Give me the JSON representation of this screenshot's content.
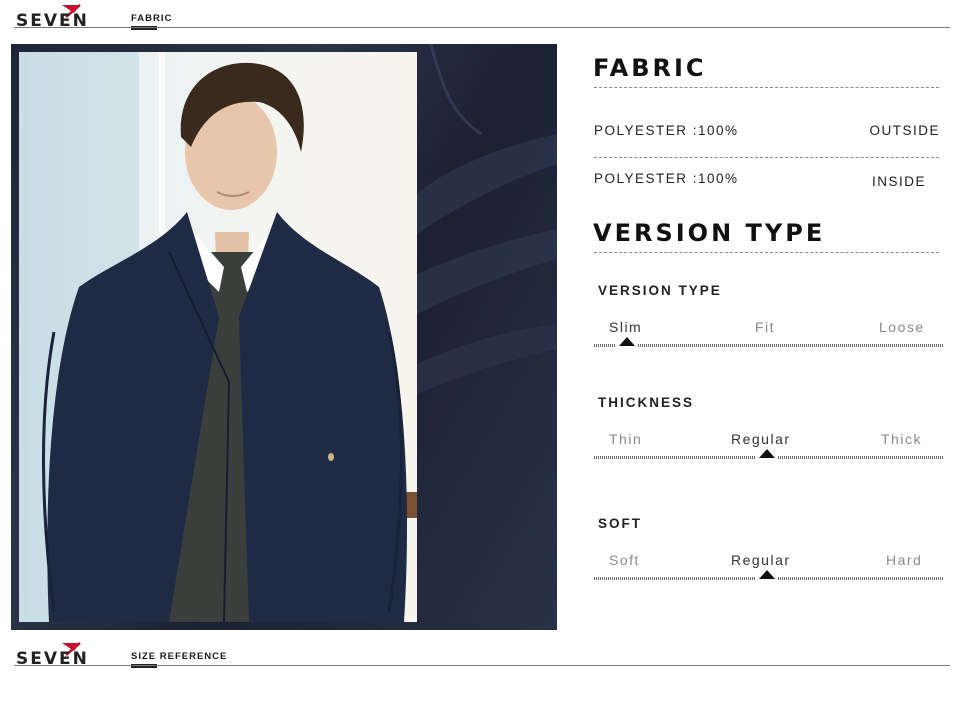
{
  "header": {
    "brand": "SEVEN",
    "section": "FABRIC"
  },
  "fabric": {
    "title": "FABRIC",
    "rows": [
      {
        "value": "POLYESTER :100%",
        "location": "OUTSIDE"
      },
      {
        "value": "POLYESTER :100%",
        "location": "INSIDE"
      }
    ]
  },
  "version": {
    "title": "VERSION TYPE",
    "attributes": [
      {
        "name": "VERSION TYPE",
        "options": [
          "Slim",
          "Fit",
          "Loose"
        ],
        "selected": "Slim"
      },
      {
        "name": "THICKNESS",
        "options": [
          "Thin",
          "Regular",
          "Thick"
        ],
        "selected": "Regular"
      },
      {
        "name": "SOFT",
        "options": [
          "Soft",
          "Regular",
          "Hard"
        ],
        "selected": "Regular"
      }
    ]
  },
  "footer": {
    "brand": "SEVEN",
    "section": "SIZE REFERENCE"
  },
  "colors": {
    "accent": "#c8102e",
    "jacket": "#1f2a44",
    "sweater": "#3a3f3c"
  }
}
